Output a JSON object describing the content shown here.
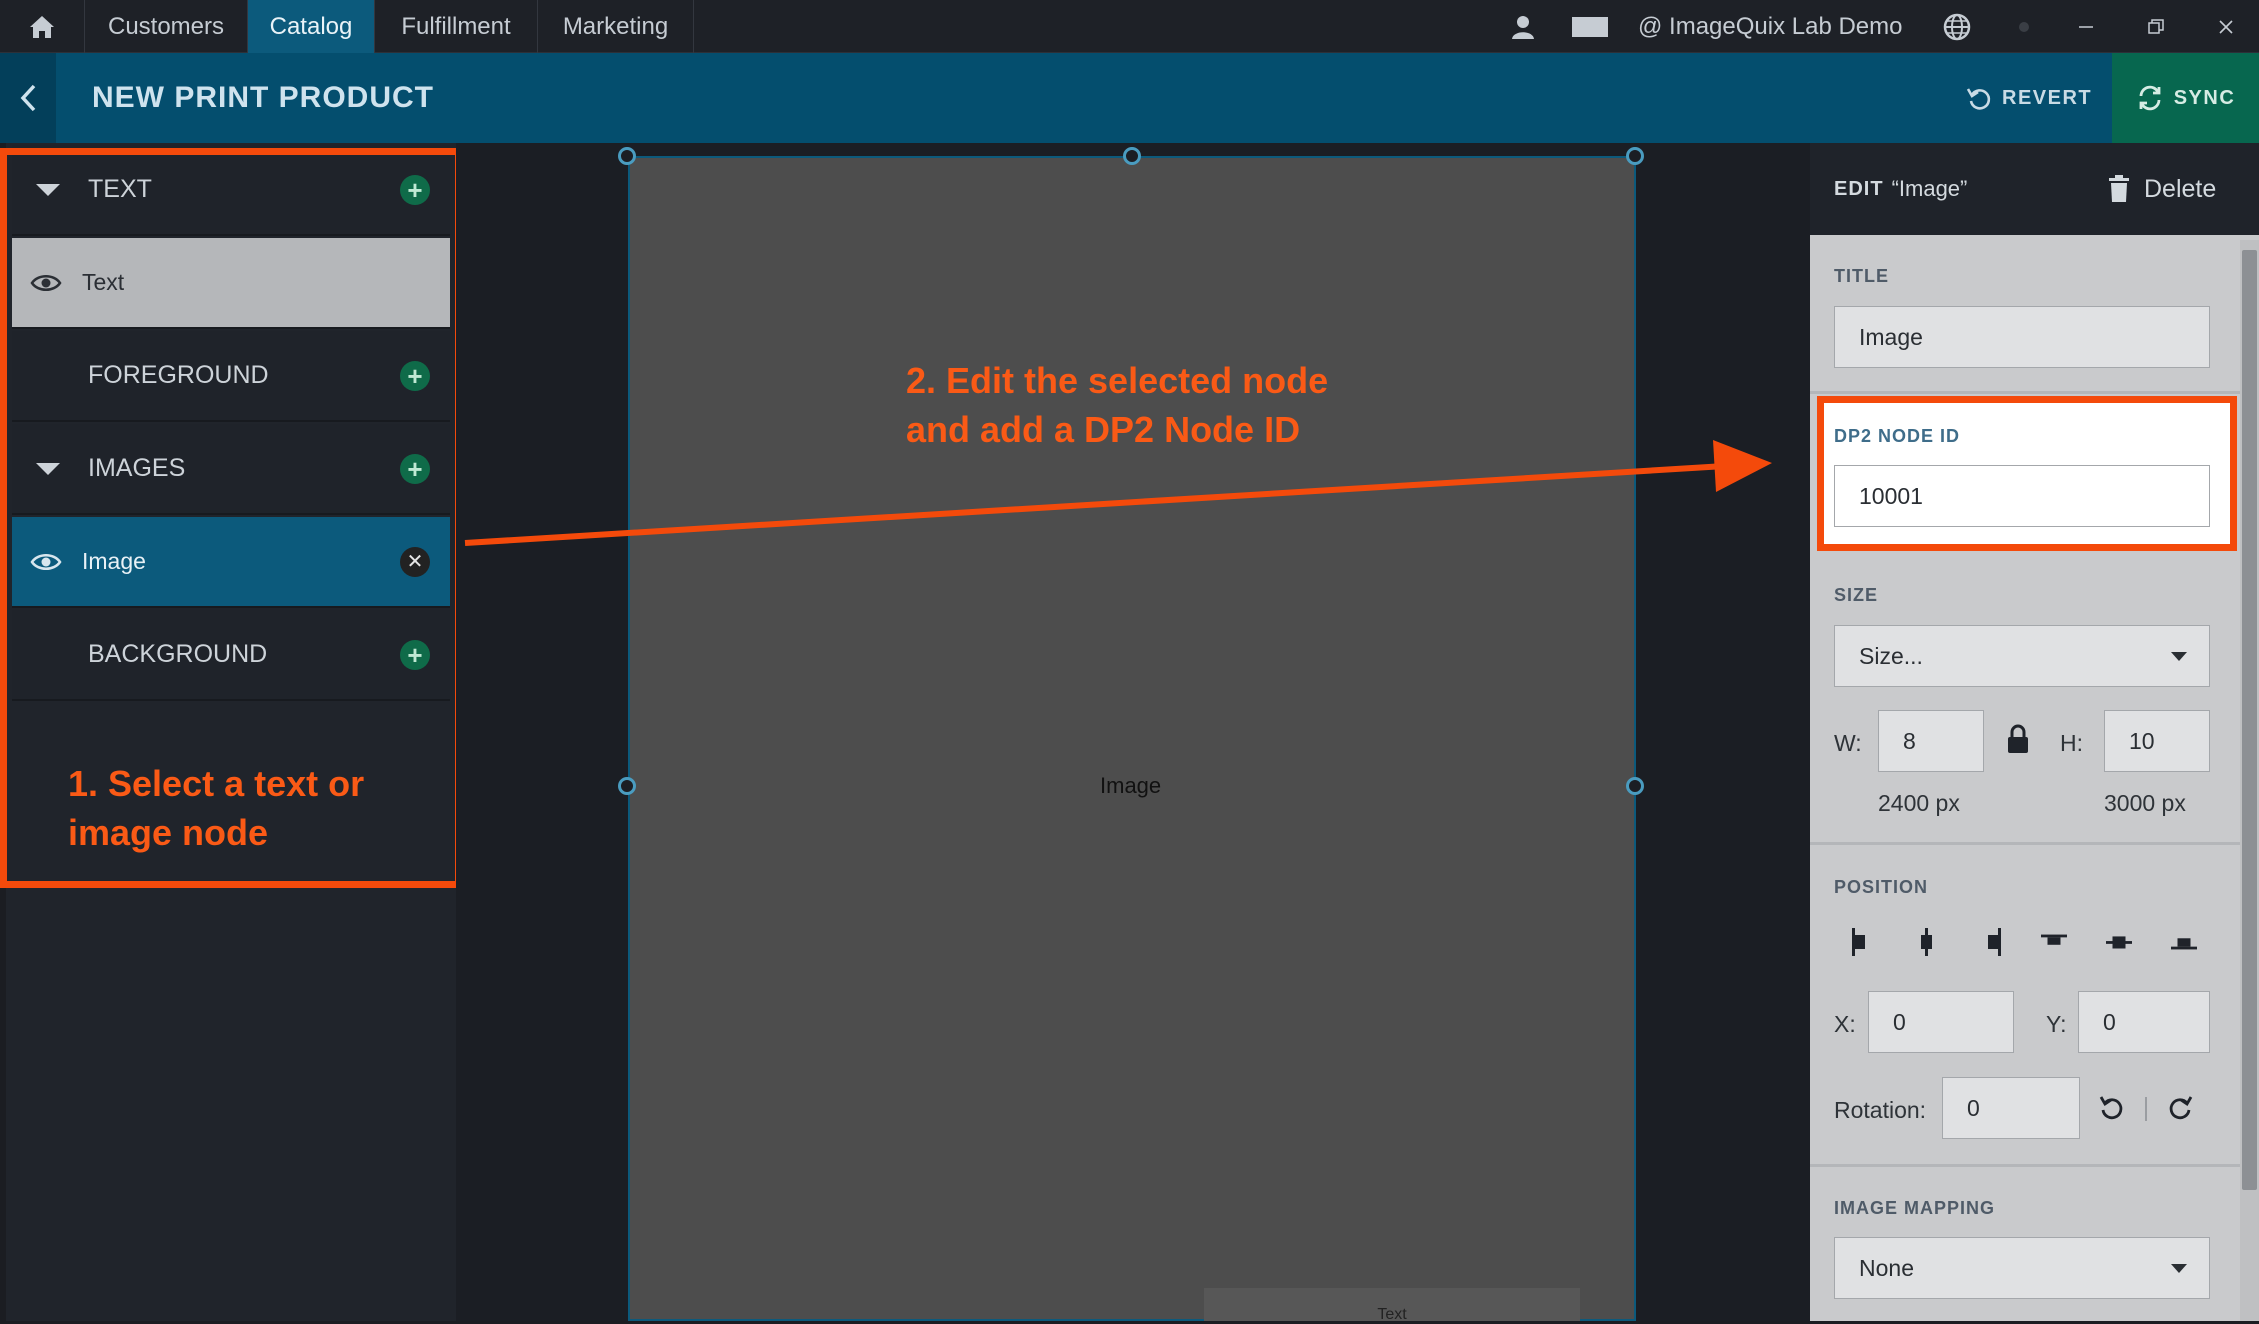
{
  "nav": {
    "tabs": [
      "Customers",
      "Catalog",
      "Fulfillment",
      "Marketing"
    ],
    "active_tab": "Catalog",
    "account": "@ ImageQuix Lab Demo"
  },
  "header": {
    "title": "NEW PRINT PRODUCT",
    "revert_label": "REVERT",
    "sync_label": "SYNC"
  },
  "layers": {
    "text_section": "TEXT",
    "text_item": "Text",
    "foreground_section": "FOREGROUND",
    "images_section": "IMAGES",
    "image_item": "Image",
    "background_section": "BACKGROUND"
  },
  "annotations": {
    "left_line1": "1. Select a text or",
    "left_line2": "image node",
    "middle_line1": "2. Edit the selected node",
    "middle_line2": "and add a DP2 Node ID"
  },
  "canvas": {
    "image_label": "Image",
    "text_label": "Text"
  },
  "editor": {
    "edit_keyword": "EDIT",
    "edit_target": "“Image”",
    "delete_label": "Delete",
    "title_label": "TITLE",
    "title_value": "Image",
    "node_id_label": "DP2 NODE ID",
    "node_id_value": "10001",
    "size_label": "SIZE",
    "size_value": "Size...",
    "w_label": "W:",
    "w_value": "8",
    "h_label": "H:",
    "h_value": "10",
    "w_px": "2400 px",
    "h_px": "3000 px",
    "position_label": "POSITION",
    "x_label": "X:",
    "x_value": "0",
    "y_label": "Y:",
    "y_value": "0",
    "rotation_label": "Rotation:",
    "rotation_value": "0",
    "mapping_label": "IMAGE MAPPING",
    "mapping_value": "None"
  },
  "colors": {
    "accent_blue": "#0c5a7c",
    "header_blue": "#044e6e",
    "sync_green": "#07674f",
    "callout_orange": "#f44a0b"
  },
  "icons": [
    "home-icon",
    "user-icon",
    "monitor-icon",
    "globe-icon",
    "minimize-icon",
    "restore-icon",
    "close-icon",
    "back-icon",
    "revert-icon",
    "sync-icon",
    "trash-icon",
    "eye-icon",
    "lock-icon",
    "rotate-left-icon",
    "rotate-right-icon"
  ]
}
